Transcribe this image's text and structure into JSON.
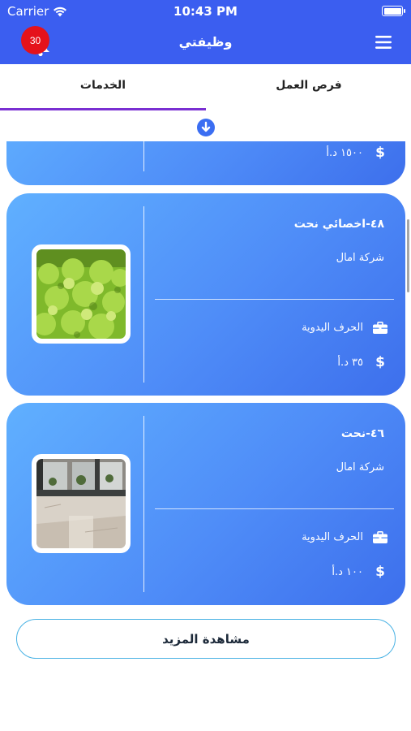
{
  "status_bar": {
    "carrier": "Carrier",
    "time": "10:43 PM"
  },
  "header": {
    "title": "وظيفتي",
    "notification_count": "30"
  },
  "tabs": [
    {
      "label": "الخدمات",
      "selected": true
    },
    {
      "label": "فرص العمل",
      "selected": false
    }
  ],
  "listings": [
    {
      "price": "١٥٠٠ د.أ"
    },
    {
      "title": "٤٨-اخصائي نحت",
      "company": "شركة امال",
      "category": "الحرف اليدوية",
      "price": "٣٥ د.أ",
      "thumbnail": "lettuce-photo"
    },
    {
      "title": "٤٦-نحت",
      "company": "شركة امال",
      "category": "الحرف اليدوية",
      "price": "١٠٠ د.أ",
      "thumbnail": "interior-photo"
    }
  ],
  "more_button": {
    "label": "مشاهدة المزيد"
  },
  "colors": {
    "header": "#3b5ef0",
    "card_light": "#60b0ff",
    "card_dark": "#3d6fec",
    "tab_indicator": "#7a2fd2",
    "badge": "#e5121b",
    "more_border": "#49b2e4"
  }
}
